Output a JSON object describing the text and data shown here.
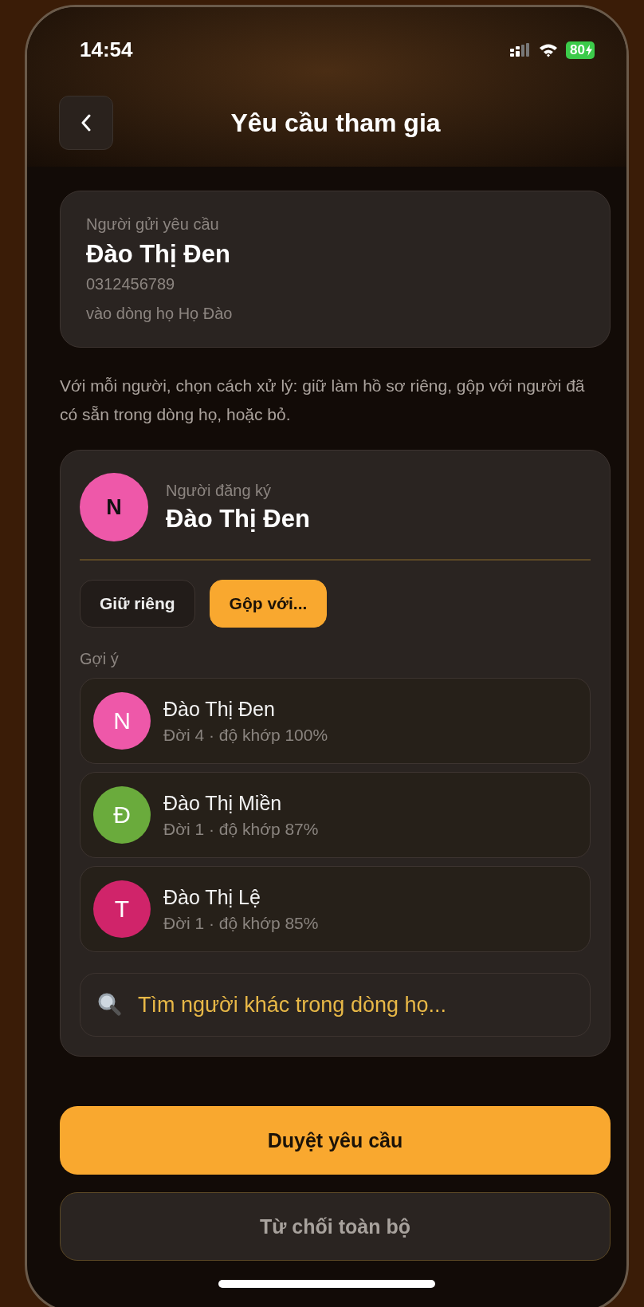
{
  "status_bar": {
    "time": "14:54",
    "battery": "80"
  },
  "header": {
    "title": "Yêu cầu tham gia"
  },
  "sender": {
    "label": "Người gửi yêu cầu",
    "name": "Đào Thị Đen",
    "phone": "0312456789",
    "family": "vào dòng họ Họ Đào"
  },
  "instructions": "Với mỗi người, chọn cách xử lý: giữ làm hồ sơ riêng, gộp với người đã có sẵn trong dòng họ, hoặc bỏ.",
  "registrant": {
    "initial": "N",
    "color": "#ee58a9",
    "label": "Người đăng ký",
    "name": "Đào Thị Đen",
    "options": [
      {
        "label": "Giữ riêng",
        "selected": false
      },
      {
        "label": "Gộp với...",
        "selected": true
      }
    ],
    "suggestions_label": "Gợi ý",
    "suggestions": [
      {
        "initial": "N",
        "color": "#ee58a9",
        "name": "Đào Thị Đen",
        "detail": "Đời 4 · độ khớp 100%"
      },
      {
        "initial": "Đ",
        "color": "#6aab3c",
        "name": "Đào Thị Miền",
        "detail": "Đời 1 · độ khớp 87%"
      },
      {
        "initial": "T",
        "color": "#d0246a",
        "name": "Đào Thị Lệ",
        "detail": "Đời 1 · độ khớp 85%"
      }
    ],
    "search": {
      "placeholder": "Tìm người khác trong dòng họ..."
    }
  },
  "actions": [
    {
      "label": "Duyệt yêu cầu",
      "kind": "primary"
    },
    {
      "label": "Từ chối toàn bộ",
      "kind": "secondary"
    }
  ]
}
